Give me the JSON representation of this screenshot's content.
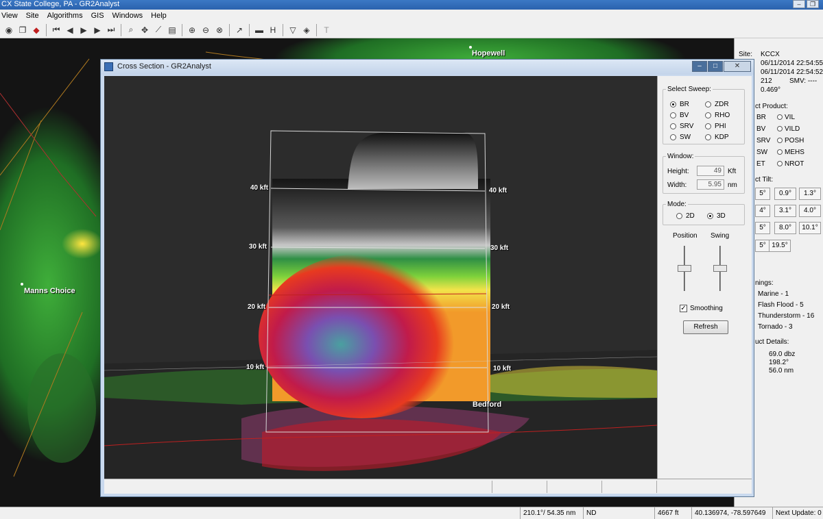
{
  "window": {
    "title": "CX State College, PA - GR2Analyst"
  },
  "menu": [
    "View",
    "Site",
    "Algorithms",
    "GIS",
    "Windows",
    "Help"
  ],
  "map": {
    "cities": [
      {
        "name": "Hopewell"
      },
      {
        "name": "Manns Choice"
      },
      {
        "name": "Bedford"
      }
    ]
  },
  "right_panel": {
    "site_label": "Site:",
    "site_value": "KCCX",
    "time1": "06/11/2014  22:54:55",
    "time2": "06/11/2014  22:54:52",
    "vcp": "212",
    "smv": "SMV:  ----",
    "elev": "0.469°",
    "select_product_label": "ct Product:",
    "products": [
      {
        "left": "BR",
        "mid": "VIL"
      },
      {
        "left": "BV",
        "mid": "VILD"
      },
      {
        "left": "SRV",
        "mid": "POSH"
      },
      {
        "left": "SW",
        "mid": "MEHS"
      },
      {
        "left": "ET",
        "mid": "NROT"
      }
    ],
    "select_tilt_label": "ct Tilt:",
    "tilts": [
      "5°",
      "0.9°",
      "1.3°",
      "4°",
      "3.1°",
      "4.0°",
      "5°",
      "8.0°",
      "10.1°",
      "5°",
      "19.5°"
    ],
    "warnings_label": "nings:",
    "warnings": [
      "Marine - 1",
      "Flash Flood - 5",
      "Thunderstorm - 16",
      "Tornado - 3"
    ],
    "details_label": "uct Details:",
    "details": [
      "69.0 dbz",
      "198.2°",
      "56.0 nm"
    ]
  },
  "status_bar": {
    "azran": "210.1°/ 54.35 nm",
    "value": "ND",
    "height": "4667 ft",
    "latlon": "40.136974, -78.597649",
    "next_update": "Next Update: 0"
  },
  "cross_section": {
    "title": "Cross Section - GR2Analyst",
    "altitude_labels": [
      "40 kft",
      "30 kft",
      "20 kft",
      "10 kft"
    ],
    "select_sweep_label": "Select Sweep:",
    "sweeps": [
      {
        "name": "BR",
        "selected": true
      },
      {
        "name": "ZDR",
        "selected": false
      },
      {
        "name": "BV",
        "selected": false
      },
      {
        "name": "RHO",
        "selected": false
      },
      {
        "name": "SRV",
        "selected": false
      },
      {
        "name": "PHI",
        "selected": false
      },
      {
        "name": "SW",
        "selected": false
      },
      {
        "name": "KDP",
        "selected": false
      }
    ],
    "window_label": "Window:",
    "height_label": "Height:",
    "height_value": "49",
    "height_unit": "Kft",
    "width_label": "Width:",
    "width_value": "5.95",
    "width_unit": "nm",
    "mode_label": "Mode:",
    "mode_2d": "2D",
    "mode_3d": "3D",
    "position_label": "Position",
    "swing_label": "Swing",
    "smoothing_label": "Smoothing",
    "smoothing_checked": true,
    "refresh_label": "Refresh"
  }
}
